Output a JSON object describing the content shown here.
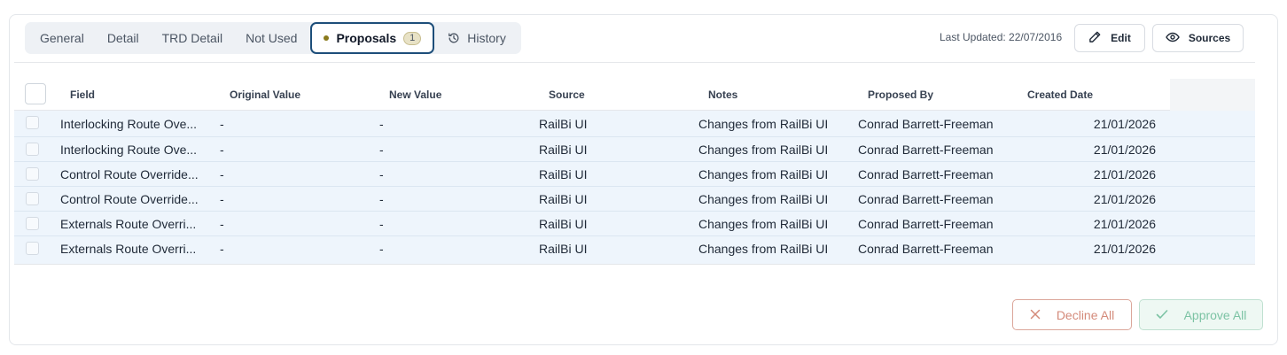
{
  "tabs": [
    {
      "label": "General"
    },
    {
      "label": "Detail"
    },
    {
      "label": "TRD Detail"
    },
    {
      "label": "Not Used"
    },
    {
      "label": "Proposals",
      "count": "1"
    },
    {
      "label": "History"
    }
  ],
  "header": {
    "last_updated": "Last Updated: 22/07/2016",
    "edit_label": "Edit",
    "sources_label": "Sources"
  },
  "table": {
    "columns": [
      "Field",
      "Original Value",
      "New Value",
      "Source",
      "Notes",
      "Proposed By",
      "Created Date"
    ],
    "rows": [
      {
        "field": "Interlocking Route Ove...",
        "original": "-",
        "new": "-",
        "source": "RailBi UI",
        "notes": "Changes from RailBi UI",
        "proposed_by": "Conrad Barrett-Freeman",
        "created": "21/01/2026"
      },
      {
        "field": "Interlocking Route Ove...",
        "original": "-",
        "new": "-",
        "source": "RailBi UI",
        "notes": "Changes from RailBi UI",
        "proposed_by": "Conrad Barrett-Freeman",
        "created": "21/01/2026"
      },
      {
        "field": "Control Route Override...",
        "original": "-",
        "new": "-",
        "source": "RailBi UI",
        "notes": "Changes from RailBi UI",
        "proposed_by": "Conrad Barrett-Freeman",
        "created": "21/01/2026"
      },
      {
        "field": "Control Route Override...",
        "original": "-",
        "new": "-",
        "source": "RailBi UI",
        "notes": "Changes from RailBi UI",
        "proposed_by": "Conrad Barrett-Freeman",
        "created": "21/01/2026"
      },
      {
        "field": "Externals Route Overri...",
        "original": "-",
        "new": "-",
        "source": "RailBi UI",
        "notes": "Changes from RailBi UI",
        "proposed_by": "Conrad Barrett-Freeman",
        "created": "21/01/2026"
      },
      {
        "field": "Externals Route Overri...",
        "original": "-",
        "new": "-",
        "source": "RailBi UI",
        "notes": "Changes from RailBi UI",
        "proposed_by": "Conrad Barrett-Freeman",
        "created": "21/01/2026"
      }
    ]
  },
  "actions": {
    "decline_label": "Decline All",
    "approve_label": "Approve All"
  },
  "icons": {
    "edit": "pencil-icon",
    "sources": "eye-icon",
    "history": "history-icon",
    "decline": "close-icon",
    "approve": "check-icon"
  },
  "colors": {
    "active_tab_border": "#1d4e7a",
    "row_bg": "#eef5fc",
    "decline": "#d48a7a",
    "approve": "#7cc3a4"
  }
}
